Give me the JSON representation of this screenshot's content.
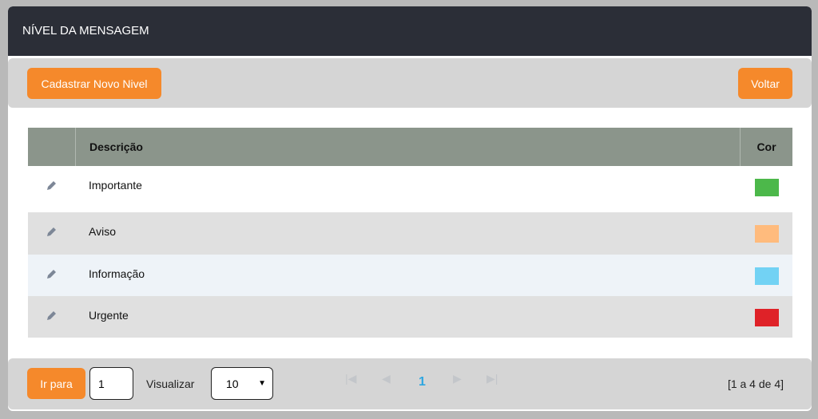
{
  "header": {
    "title": "NÍVEL DA MENSAGEM"
  },
  "toolbar": {
    "new_label": "Cadastrar Novo Nivel",
    "back_label": "Voltar"
  },
  "table": {
    "columns": [
      "",
      "Descrição",
      "Cor"
    ],
    "rows": [
      {
        "descricao": "Importante",
        "cor": "#4cb84a"
      },
      {
        "descricao": "Aviso",
        "cor": "#ffbb7d"
      },
      {
        "descricao": "Informação",
        "cor": "#72d2f4"
      },
      {
        "descricao": "Urgente",
        "cor": "#df2228"
      }
    ]
  },
  "footer": {
    "goto_label": "Ir para",
    "goto_value": "1",
    "view_label": "Visualizar",
    "page_size": "10",
    "current_page": "1",
    "summary": "[1 a 4 de 4]"
  },
  "colors": {
    "accent": "#f5892b",
    "header_bg": "#2b2e37",
    "active_page": "#2ea6e0"
  }
}
